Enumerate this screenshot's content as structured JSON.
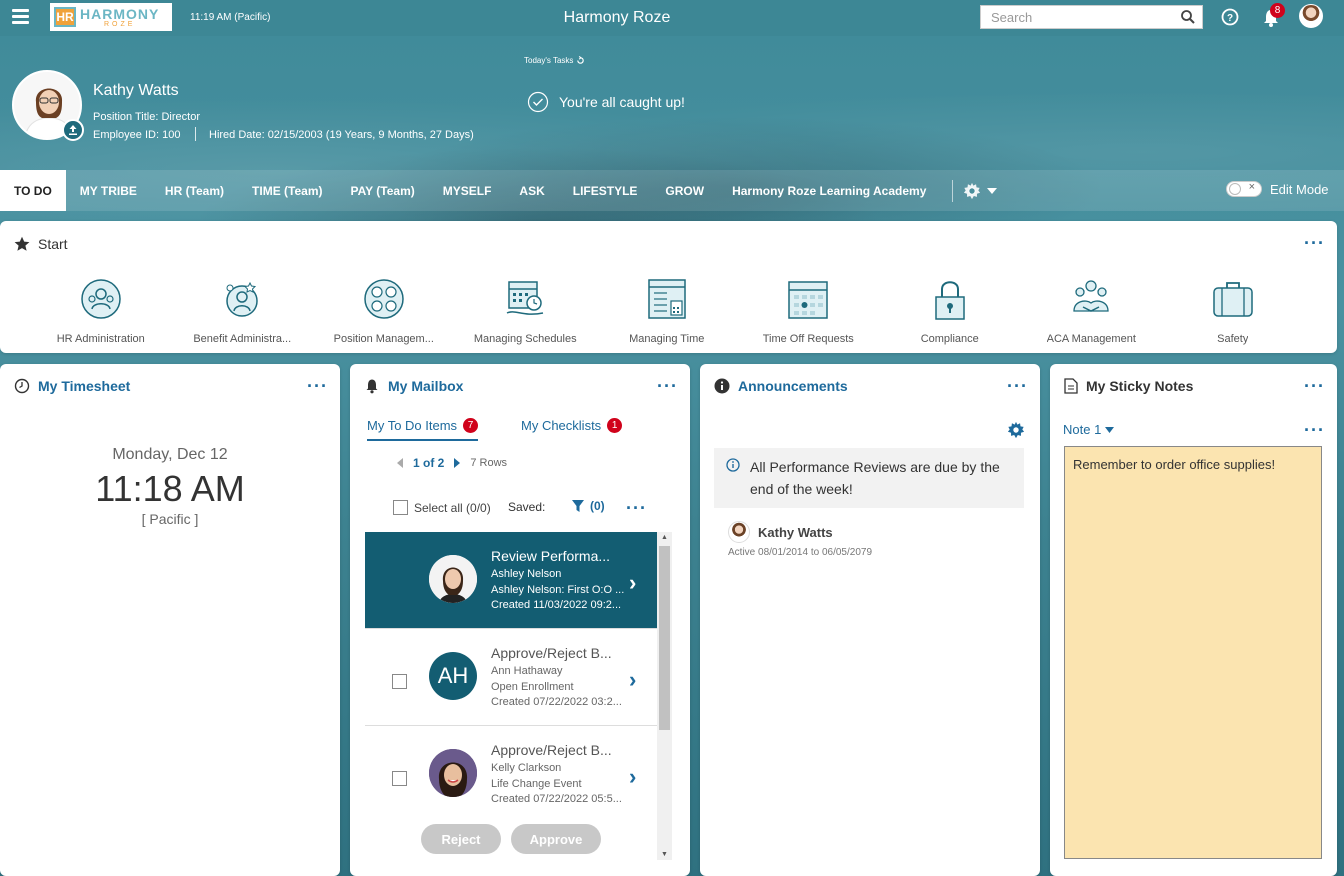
{
  "topbar": {
    "logo_text": "HARMONY",
    "logo_sub": "ROZE",
    "logo_mark": "HR",
    "time": "11:19 AM (Pacific)",
    "title": "Harmony Roze",
    "search_placeholder": "Search",
    "notification_count": "8"
  },
  "profile": {
    "name": "Kathy Watts",
    "title": "Position Title: Director",
    "employee_id": "Employee ID: 100",
    "hired": "Hired Date: 02/15/2003 (19 Years, 9 Months, 27 Days)"
  },
  "tasks": {
    "label": "Today's Tasks",
    "message": "You're all caught up!"
  },
  "nav": {
    "tabs": [
      "TO DO",
      "MY TRIBE",
      "HR (Team)",
      "TIME (Team)",
      "PAY (Team)",
      "MYSELF",
      "ASK",
      "LIFESTYLE",
      "GROW",
      "Harmony Roze Learning Academy"
    ],
    "active": "TO DO",
    "edit_mode": "Edit Mode"
  },
  "start": {
    "title": "Start",
    "items": [
      {
        "label": "HR Administration",
        "icon": "hr-admin-icon"
      },
      {
        "label": "Benefit Administra...",
        "icon": "benefit-icon"
      },
      {
        "label": "Position Managem...",
        "icon": "position-icon"
      },
      {
        "label": "Managing Schedules",
        "icon": "schedules-icon"
      },
      {
        "label": "Managing Time",
        "icon": "time-icon"
      },
      {
        "label": "Time Off Requests",
        "icon": "calendar-icon"
      },
      {
        "label": "Compliance",
        "icon": "lock-icon"
      },
      {
        "label": "ACA Management",
        "icon": "aca-icon"
      },
      {
        "label": "Safety",
        "icon": "briefcase-icon"
      }
    ]
  },
  "timesheet": {
    "title": "My Timesheet",
    "date": "Monday, Dec 12",
    "time": "11:18 AM",
    "tz": "[ Pacific ]"
  },
  "mailbox": {
    "title": "My Mailbox",
    "tab_todo": "My To Do Items",
    "tab_todo_count": "7",
    "tab_check": "My Checklists",
    "tab_check_count": "1",
    "pager": "1 of 2",
    "rows": "7 Rows",
    "select_all": "Select all (0/0)",
    "saved": "Saved:",
    "filter_count": "(0)",
    "items": [
      {
        "title": "Review Performa...",
        "name": "Ashley Nelson",
        "detail": "Ashley Nelson: First O:O ...",
        "created": "Created 11/03/2022 09:2..."
      },
      {
        "title": "Approve/Reject B...",
        "initials": "AH",
        "name": "Ann Hathaway",
        "detail": "Open Enrollment",
        "created": "Created 07/22/2022 03:2..."
      },
      {
        "title": "Approve/Reject B...",
        "name": "Kelly Clarkson",
        "detail": "Life Change Event",
        "created": "Created 07/22/2022 05:5..."
      }
    ],
    "reject": "Reject",
    "approve": "Approve"
  },
  "announcements": {
    "title": "Announcements",
    "message": "All Performance Reviews are due by the end of the week!",
    "author": "Kathy Watts",
    "active": "Active 08/01/2014 to 06/05/2079"
  },
  "sticky": {
    "title": "My Sticky Notes",
    "note_tab": "Note 1",
    "note_text": "Remember to order office supplies!"
  },
  "colors": {
    "header_teal": "#3d8795",
    "accent_blue": "#1e6a9c",
    "selected_row": "#135d72",
    "badge_red": "#d0021b",
    "sticky_yellow": "#fbe4b0"
  }
}
